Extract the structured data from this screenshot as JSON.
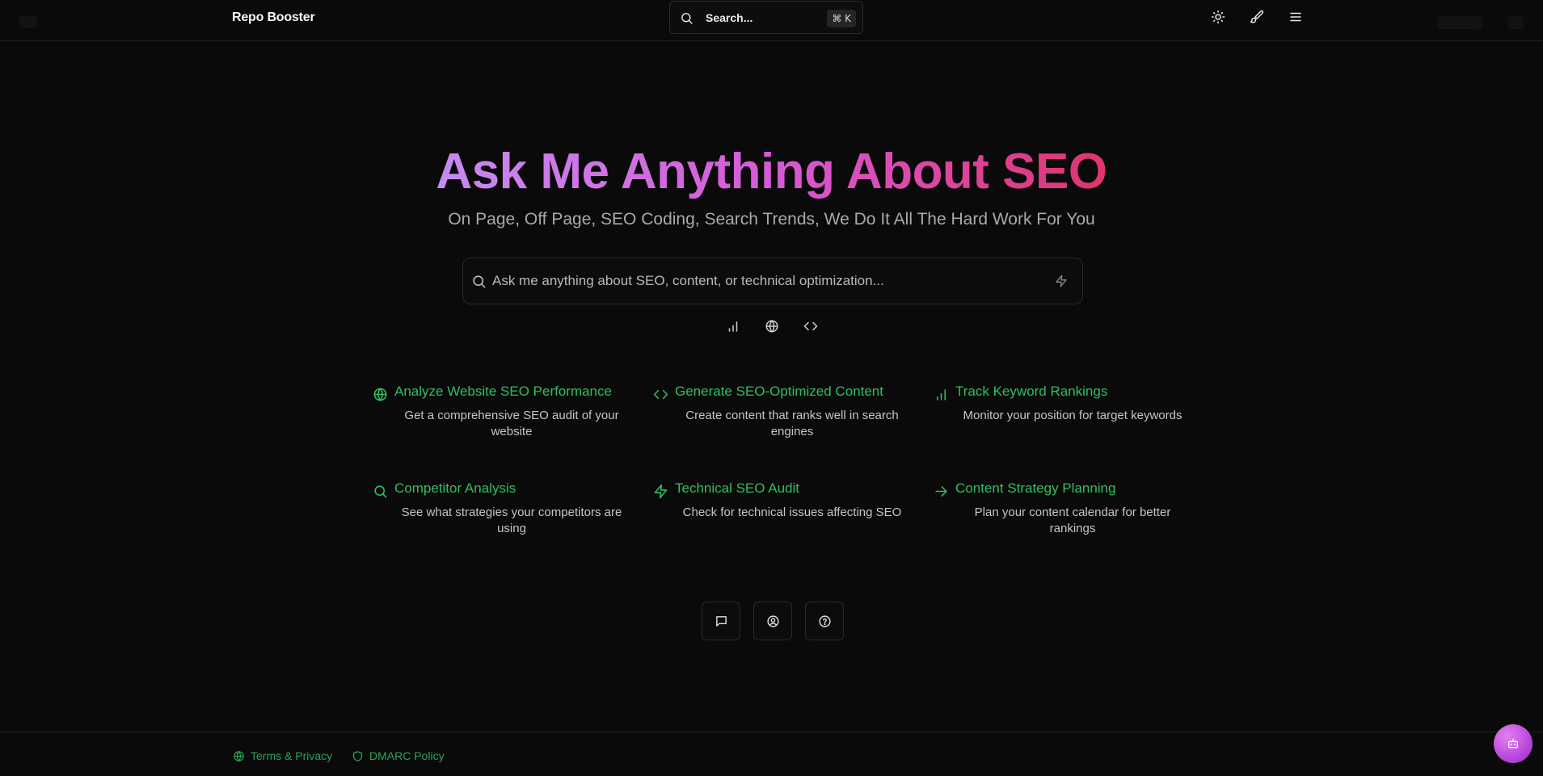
{
  "header": {
    "brand": "Repo Booster",
    "search_label": "Search...",
    "search_shortcut": "⌘ K",
    "icons": [
      "sun-icon",
      "paintbrush-icon",
      "menu-icon"
    ]
  },
  "hero": {
    "title": "Ask Me Anything About SEO",
    "subtitle": "On Page, Off Page, SEO Coding, Search Trends, We Do It All The Hard Work For You",
    "ask_placeholder": "Ask me anything about SEO, content, or technical optimization...",
    "mode_icons": [
      "bar-chart-icon",
      "globe-icon",
      "code-icon"
    ]
  },
  "cards": [
    {
      "icon": "globe-icon",
      "title": "Analyze Website SEO Performance",
      "desc": "Get a comprehensive SEO audit of your website"
    },
    {
      "icon": "code-icon",
      "title": "Generate SEO-Optimized Content",
      "desc": "Create content that ranks well in search engines"
    },
    {
      "icon": "bar-chart-icon",
      "title": "Track Keyword Rankings",
      "desc": "Monitor your position for target keywords"
    },
    {
      "icon": "search-icon",
      "title": "Competitor Analysis",
      "desc": "See what strategies your competitors are using"
    },
    {
      "icon": "zap-icon",
      "title": "Technical SEO Audit",
      "desc": "Check for technical issues affecting SEO"
    },
    {
      "icon": "arrow-right-icon",
      "title": "Content Strategy Planning",
      "desc": "Plan your content calendar for better rankings"
    }
  ],
  "bottom_actions": [
    "chat-icon",
    "user-circle-icon",
    "help-circle-icon"
  ],
  "footer": {
    "links": [
      {
        "icon": "globe-icon",
        "label": "Terms & Privacy"
      },
      {
        "icon": "shield-icon",
        "label": "DMARC Policy"
      }
    ]
  },
  "colors": {
    "background": "#0b0a0a",
    "accent_green": "#2fbf5f",
    "title_gradient_start": "#c58cf0",
    "title_gradient_end": "#e1336f",
    "fab": "#c04fe0"
  }
}
